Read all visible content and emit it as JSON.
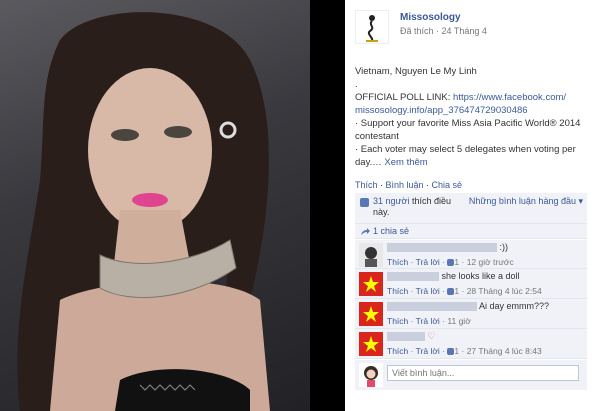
{
  "post": {
    "page_name": "Missosology",
    "liked_status": "Đã thích",
    "date": "24 Tháng 4",
    "title_line": "Vietnam, Nguyen Le My Linh",
    "dot": ".",
    "poll_label": "OFFICIAL POLL LINK:",
    "poll_link": "https://www.facebook.com/missosology.info/app_376474729030486",
    "poll_link_line1": "https://www.facebook.com/",
    "poll_link_line2": "missosology.info/app_376474729030486",
    "support_line": "· Support your favorite Miss Asia Pacific World® 2014 contestant",
    "each_voter_line": "· Each voter may select 5 delegates when voting per day.…",
    "see_more": "Xem thêm"
  },
  "actions": {
    "like": "Thích",
    "comment": "Bình luận",
    "share": "Chia sẻ",
    "sep": " · "
  },
  "likes": {
    "text_count": "31 người",
    "text_rest": "thích điều này.",
    "sort_label": "Những bình luận hàng đầu ▾"
  },
  "shares": {
    "text": "1 chia sẻ"
  },
  "comments": [
    {
      "text": ":))",
      "like": "Thích",
      "reply": "Trả lời",
      "likes": "1",
      "time": "12 giờ trước"
    },
    {
      "text": "she looks like a doll",
      "like": "Thích",
      "reply": "Trả lời",
      "likes": "1",
      "time": "28 Tháng 4 lúc 2:54"
    },
    {
      "text": "Ai day emmm???",
      "like": "Thích",
      "reply": "Trả lời",
      "likes": "",
      "time": "11 giờ"
    },
    {
      "text": "♡",
      "like": "Thích",
      "reply": "Trả lời",
      "likes": "1",
      "time": "27 Tháng 4 lúc 8:43"
    }
  ],
  "write": {
    "placeholder": "Viết bình luận..."
  },
  "colors": {
    "link": "#3b5998",
    "panel": "#f0f2f7",
    "vn_flag_red": "#da251d",
    "vn_flag_star": "#ffff00"
  },
  "icons": [
    "like-thumb-icon",
    "share-icon",
    "vietnam-flag-avatar",
    "girl-cartoon-avatar",
    "logo-silhouette-icon"
  ]
}
